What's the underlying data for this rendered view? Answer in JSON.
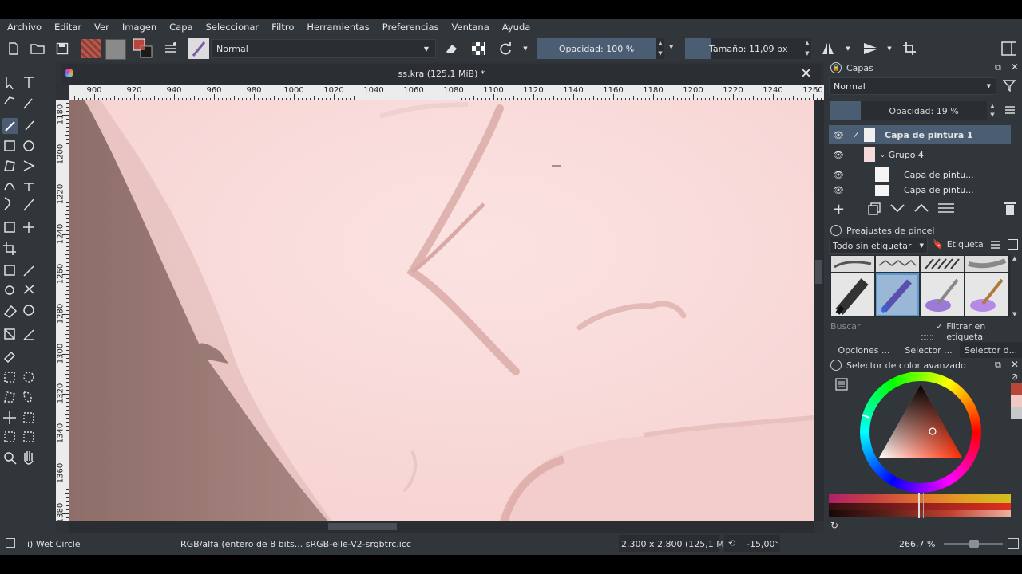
{
  "menubar": {
    "items": [
      "Archivo",
      "Editar",
      "Ver",
      "Imagen",
      "Capa",
      "Seleccionar",
      "Filtro",
      "Herramientas",
      "Preferencias",
      "Ventana",
      "Ayuda"
    ]
  },
  "toolbar": {
    "blend_mode": "Normal",
    "opacity_label": "Opacidad: 100 %",
    "size_label": "Tamaño: 11,09 px"
  },
  "document": {
    "tab_title": "ss.kra (125,1 MiB) *",
    "ruler_h": [
      "900",
      "920",
      "940",
      "960",
      "980",
      "1000",
      "1020",
      "1040",
      "1060",
      "1080",
      "1100",
      "1120",
      "1140",
      "1160",
      "1180",
      "1200",
      "1220",
      "1240",
      "1260"
    ],
    "ruler_v": [
      "1180",
      "1200",
      "1220",
      "1240",
      "1260",
      "1280",
      "1300",
      "1320",
      "1340",
      "1360",
      "1380"
    ]
  },
  "layers_panel": {
    "title": "Capas",
    "blend_mode": "Normal",
    "opacity_label": "Opacidad:  19 %",
    "layers": [
      {
        "name": "Capa de pintura 1",
        "selected": true
      },
      {
        "name": "Grupo 4",
        "selected": false
      },
      {
        "name": "Capa de pintu...",
        "selected": false
      },
      {
        "name": "Capa de pintu...",
        "selected": false
      }
    ]
  },
  "brush_presets": {
    "title": "Preajustes de pincel",
    "tag_filter": "Todo sin etiquetar",
    "tag_button": "Etiqueta",
    "search_placeholder": "Buscar",
    "filter_label": "Filtrar en etiqueta"
  },
  "bottom_tabs": [
    "Opciones ...",
    "Selector ...",
    "Selector d..."
  ],
  "color_selector": {
    "title": "Selector de color avanzado",
    "colors": {
      "foreground": "#b8463a",
      "background": "#c0c0c0"
    }
  },
  "statusbar": {
    "brush_name": "i) Wet Circle",
    "color_profile": "RGB/alfa (entero de 8 bits...  sRGB-elle-V2-srgbtrc.icc",
    "image_size": "2.300 x 2.800 (125,1 MiB)",
    "rotation": "-15,00°",
    "zoom": "266,7 %"
  }
}
